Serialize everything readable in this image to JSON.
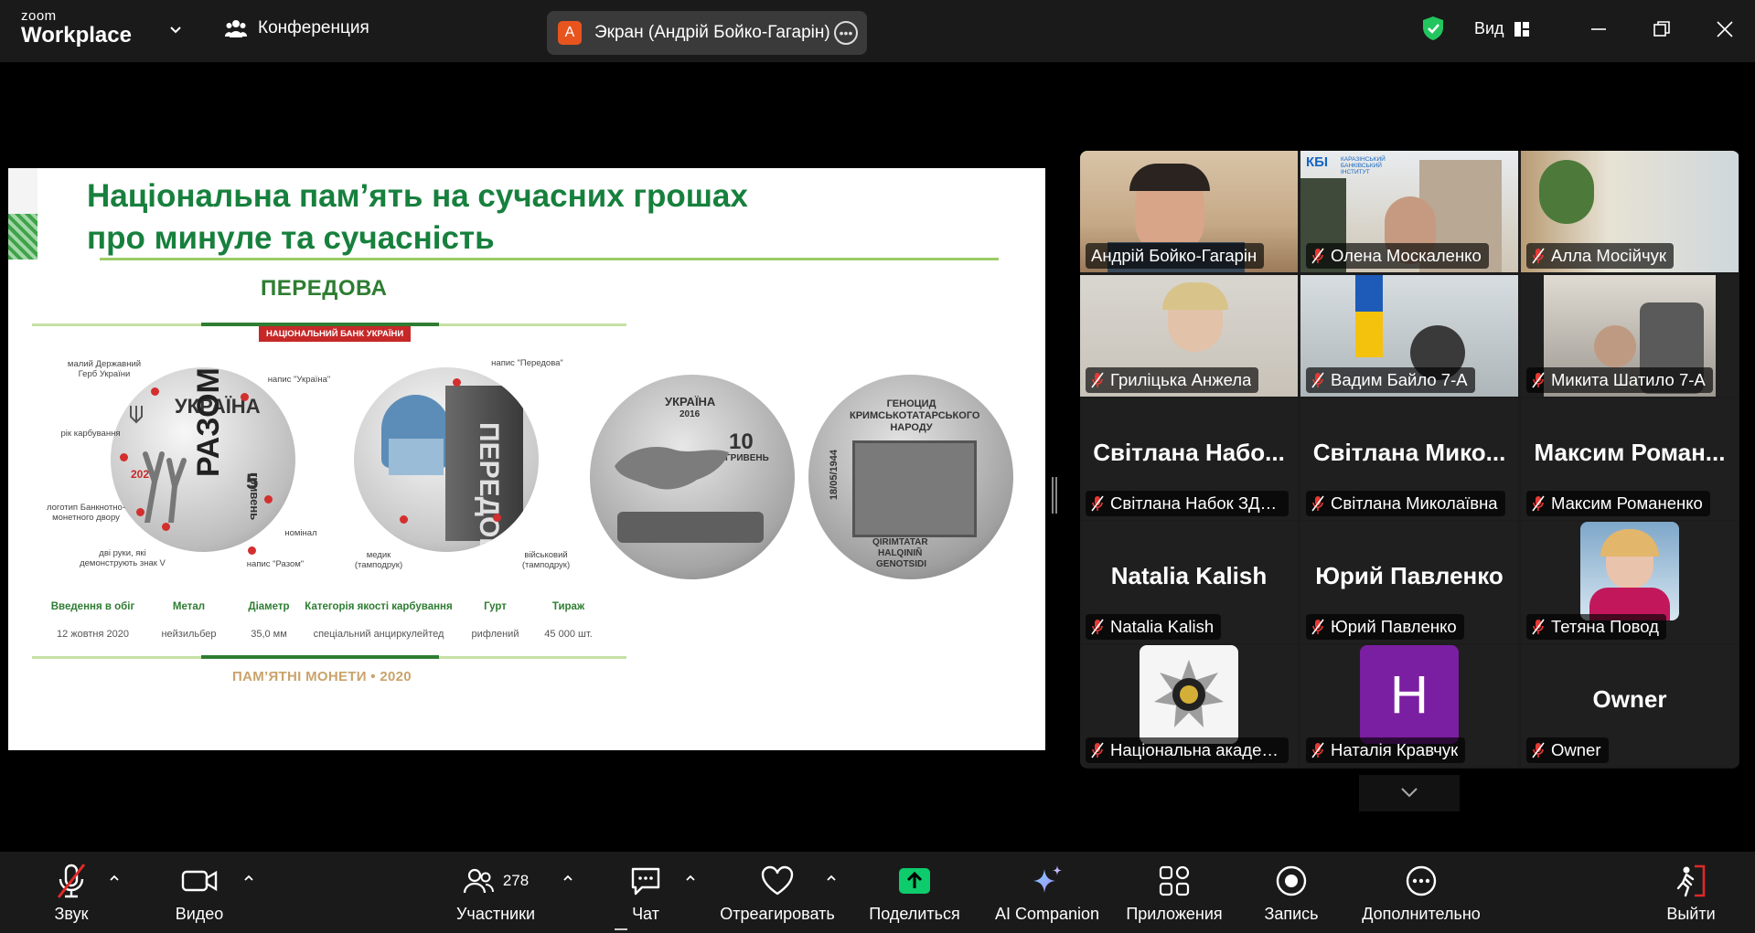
{
  "app": {
    "logo_small": "zoom",
    "logo_big": "Workplace",
    "meeting_label": "Конференция",
    "screen_share": {
      "avatar_letter": "A",
      "label": "Экран (Андрій Бойко-Гагарін)"
    },
    "view_label": "Вид"
  },
  "slide": {
    "title_line1": "Національна пам’ять на сучасних грошах",
    "title_line2": "про минуле та сучасність",
    "coin_name": "ПЕРЕДОВА",
    "nbu_badge": "НАЦІОНАЛЬНИЙ БАНК УКРАЇНИ",
    "coin1": {
      "country": "УКРАЇНА",
      "word": "РАЗОМ",
      "year": "2020",
      "value": "5",
      "currency": "гривень"
    },
    "coin2": {
      "word": "ПЕРЕДОВА"
    },
    "coin3": {
      "country": "УКРАЇНА",
      "year": "2016",
      "value": "10",
      "currency": "ГРИВЕНЬ"
    },
    "coin4": {
      "top": "ГЕНОЦИД КРИМСЬКОТАТАРСЬКОГО НАРОДУ",
      "date": "18/05/1944",
      "bottom1": "QIRIMTATAR",
      "bottom2": "HALQINIÑ",
      "bottom3": "GENOTSIDI"
    },
    "annotations": {
      "coat": "малий Державний Герб України",
      "ukraine": "напис \"Україна\"",
      "year": "рік карбування",
      "logo": "логотип Банкнотно-монетного двору",
      "hands": "дві руки, які демонструють знак V",
      "nominal": "номінал",
      "razom": "напис \"Разом\"",
      "peredova": "напис \"Передова\"",
      "medic": "медик (тамподрук)",
      "soldier": "військовий (тамподрук)"
    },
    "specs": [
      {
        "h": "Введення в обіг",
        "v": "12 жовтня 2020"
      },
      {
        "h": "Метал",
        "v": "нейзильбер"
      },
      {
        "h": "Діаметр",
        "v": "35,0 мм"
      },
      {
        "h": "Категорія якості карбування",
        "v": "спеціальний анциркулейтед"
      },
      {
        "h": "Гурт",
        "v": "рифлений"
      },
      {
        "h": "Тираж",
        "v": "45 000 шт."
      }
    ],
    "footer": "ПАМ’ЯТНІ МОНЕТИ • 2020"
  },
  "gallery": {
    "tiles": [
      {
        "big": "",
        "label": "Андрій Бойко-Гагарін",
        "muted": false,
        "active": true
      },
      {
        "big": "",
        "label": "Олена Москаленко",
        "muted": true
      },
      {
        "big": "",
        "label": "Алла Мосійчук",
        "muted": true
      },
      {
        "big": "",
        "label": "Гриліцька Анжела",
        "muted": true
      },
      {
        "big": "",
        "label": "Вадим Байло 7-А",
        "muted": true
      },
      {
        "big": "",
        "label": "Микита Шатило 7-А",
        "muted": true
      },
      {
        "big": "Світлана Набо...",
        "label": "Світлана Набок ЗДО ...",
        "muted": true
      },
      {
        "big": "Світлана Мико...",
        "label": "Світлана Миколаївна",
        "muted": true
      },
      {
        "big": "Максим Роман...",
        "label": "Максим Романенко",
        "muted": true
      },
      {
        "big": "Natalia Kalish",
        "label": "Natalia Kalish",
        "muted": true
      },
      {
        "big": "Юрий Павленко",
        "label": "Юрий Павленко",
        "muted": true
      },
      {
        "big": "",
        "label": "Тетяна Повод",
        "muted": true
      },
      {
        "big": "",
        "label": "Національна академі...",
        "muted": true
      },
      {
        "big": "H",
        "label": "Наталія Кравчук",
        "muted": true
      },
      {
        "big": "Owner",
        "label": "Owner",
        "muted": true
      }
    ],
    "kbi_logo_text": "КБІ",
    "kbi_logo_sub": "КАРАЗІНСЬКИЙ БАНКІВСЬКИЙ ІНСТИТУТ"
  },
  "toolbar": {
    "audio": "Звук",
    "video": "Видео",
    "participants": "Участники",
    "participants_count": "278",
    "chat": "Чат",
    "react": "Отреагировать",
    "share": "Поделиться",
    "ai": "AI Companion",
    "apps": "Приложения",
    "record": "Запись",
    "more": "Дополнительно",
    "leave": "Выйти"
  },
  "colors": {
    "accent_green": "#22c55e",
    "share_green": "#0ecb6c",
    "leave_red": "#e02828",
    "slide_green": "#17803d"
  }
}
